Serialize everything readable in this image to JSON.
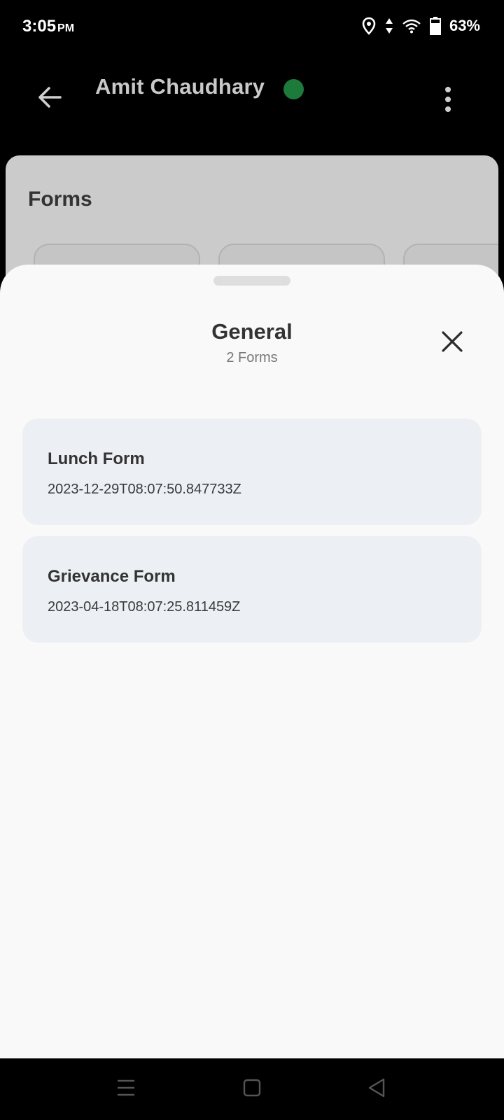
{
  "status_bar": {
    "time": "3:05",
    "ampm": "PM",
    "battery": "63%",
    "icons": [
      "location-icon",
      "data-arrows-icon",
      "wifi-icon",
      "battery-icon"
    ]
  },
  "header": {
    "contact_name": "Amit Chaudhary",
    "online_color": "#1c7a3b",
    "back_icon": "arrow-left-icon",
    "menu_icon": "more-vert-icon"
  },
  "background": {
    "section_title": "Forms"
  },
  "sheet": {
    "title": "General",
    "subtitle": "2 Forms",
    "close_icon": "close-icon",
    "forms": [
      {
        "name": "Lunch Form",
        "date": "2023-12-29T08:07:50.847733Z"
      },
      {
        "name": "Grievance Form",
        "date": "2023-04-18T08:07:25.811459Z"
      }
    ]
  },
  "nav_bar": {
    "icons": [
      "menu-icon",
      "home-icon",
      "back-icon"
    ]
  }
}
